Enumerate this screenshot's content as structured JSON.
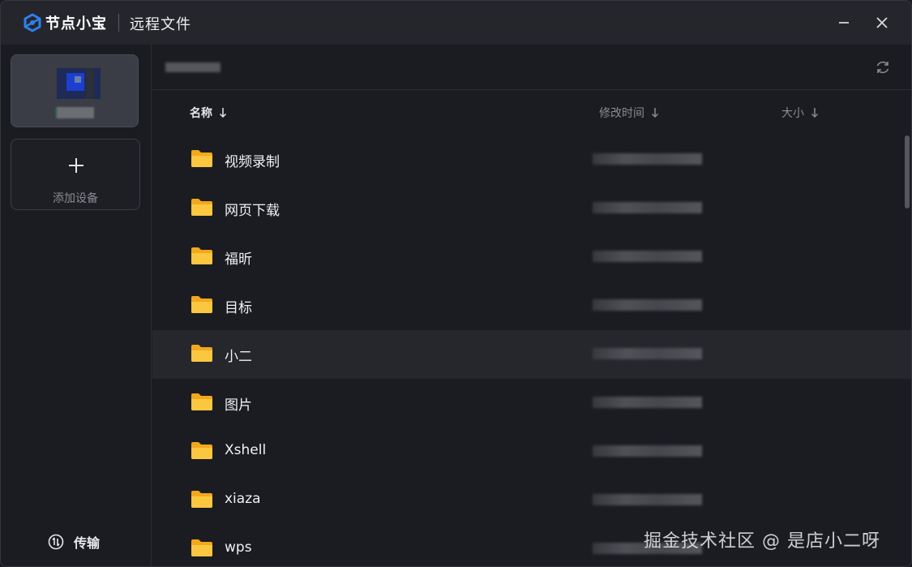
{
  "titlebar": {
    "app_name": "节点小宝",
    "page_title": "远程文件",
    "minimize_icon": "minimize-icon",
    "close_icon": "close-icon"
  },
  "sidebar": {
    "add_device_label": "添加设备",
    "transfer_label": "传输"
  },
  "file_list": {
    "columns": {
      "name": "名称",
      "modified": "修改时间",
      "size": "大小"
    },
    "sort_icon": "arrow-down-icon",
    "items": [
      {
        "name": "视频录制",
        "icon": "folder-icon"
      },
      {
        "name": "网页下载",
        "icon": "folder-icon"
      },
      {
        "name": "福昕",
        "icon": "folder-icon"
      },
      {
        "name": "目标",
        "icon": "folder-icon"
      },
      {
        "name": "小二",
        "icon": "folder-icon"
      },
      {
        "name": "图片",
        "icon": "folder-icon"
      },
      {
        "name": "Xshell",
        "icon": "folder-icon"
      },
      {
        "name": "xiaza",
        "icon": "folder-icon"
      },
      {
        "name": "wps",
        "icon": "folder-icon"
      }
    ]
  },
  "watermark": "掘金技术社区 @ 是店小二呀",
  "colors": {
    "background": "#1b1c21",
    "titlebar": "#24262c",
    "accent": "#2f80ed",
    "folder": "#f5b82e"
  }
}
